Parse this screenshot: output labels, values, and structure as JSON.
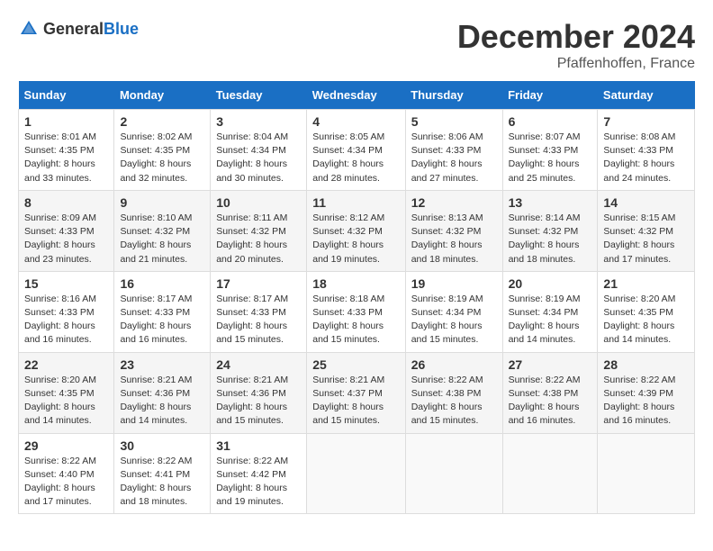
{
  "header": {
    "logo_general": "General",
    "logo_blue": "Blue",
    "title": "December 2024",
    "location": "Pfaffenhoffen, France"
  },
  "days_of_week": [
    "Sunday",
    "Monday",
    "Tuesday",
    "Wednesday",
    "Thursday",
    "Friday",
    "Saturday"
  ],
  "weeks": [
    [
      {
        "day": "1",
        "sunrise": "8:01 AM",
        "sunset": "4:35 PM",
        "daylight": "8 hours and 33 minutes."
      },
      {
        "day": "2",
        "sunrise": "8:02 AM",
        "sunset": "4:35 PM",
        "daylight": "8 hours and 32 minutes."
      },
      {
        "day": "3",
        "sunrise": "8:04 AM",
        "sunset": "4:34 PM",
        "daylight": "8 hours and 30 minutes."
      },
      {
        "day": "4",
        "sunrise": "8:05 AM",
        "sunset": "4:34 PM",
        "daylight": "8 hours and 28 minutes."
      },
      {
        "day": "5",
        "sunrise": "8:06 AM",
        "sunset": "4:33 PM",
        "daylight": "8 hours and 27 minutes."
      },
      {
        "day": "6",
        "sunrise": "8:07 AM",
        "sunset": "4:33 PM",
        "daylight": "8 hours and 25 minutes."
      },
      {
        "day": "7",
        "sunrise": "8:08 AM",
        "sunset": "4:33 PM",
        "daylight": "8 hours and 24 minutes."
      }
    ],
    [
      {
        "day": "8",
        "sunrise": "8:09 AM",
        "sunset": "4:33 PM",
        "daylight": "8 hours and 23 minutes."
      },
      {
        "day": "9",
        "sunrise": "8:10 AM",
        "sunset": "4:32 PM",
        "daylight": "8 hours and 21 minutes."
      },
      {
        "day": "10",
        "sunrise": "8:11 AM",
        "sunset": "4:32 PM",
        "daylight": "8 hours and 20 minutes."
      },
      {
        "day": "11",
        "sunrise": "8:12 AM",
        "sunset": "4:32 PM",
        "daylight": "8 hours and 19 minutes."
      },
      {
        "day": "12",
        "sunrise": "8:13 AM",
        "sunset": "4:32 PM",
        "daylight": "8 hours and 18 minutes."
      },
      {
        "day": "13",
        "sunrise": "8:14 AM",
        "sunset": "4:32 PM",
        "daylight": "8 hours and 18 minutes."
      },
      {
        "day": "14",
        "sunrise": "8:15 AM",
        "sunset": "4:32 PM",
        "daylight": "8 hours and 17 minutes."
      }
    ],
    [
      {
        "day": "15",
        "sunrise": "8:16 AM",
        "sunset": "4:33 PM",
        "daylight": "8 hours and 16 minutes."
      },
      {
        "day": "16",
        "sunrise": "8:17 AM",
        "sunset": "4:33 PM",
        "daylight": "8 hours and 16 minutes."
      },
      {
        "day": "17",
        "sunrise": "8:17 AM",
        "sunset": "4:33 PM",
        "daylight": "8 hours and 15 minutes."
      },
      {
        "day": "18",
        "sunrise": "8:18 AM",
        "sunset": "4:33 PM",
        "daylight": "8 hours and 15 minutes."
      },
      {
        "day": "19",
        "sunrise": "8:19 AM",
        "sunset": "4:34 PM",
        "daylight": "8 hours and 15 minutes."
      },
      {
        "day": "20",
        "sunrise": "8:19 AM",
        "sunset": "4:34 PM",
        "daylight": "8 hours and 14 minutes."
      },
      {
        "day": "21",
        "sunrise": "8:20 AM",
        "sunset": "4:35 PM",
        "daylight": "8 hours and 14 minutes."
      }
    ],
    [
      {
        "day": "22",
        "sunrise": "8:20 AM",
        "sunset": "4:35 PM",
        "daylight": "8 hours and 14 minutes."
      },
      {
        "day": "23",
        "sunrise": "8:21 AM",
        "sunset": "4:36 PM",
        "daylight": "8 hours and 14 minutes."
      },
      {
        "day": "24",
        "sunrise": "8:21 AM",
        "sunset": "4:36 PM",
        "daylight": "8 hours and 15 minutes."
      },
      {
        "day": "25",
        "sunrise": "8:21 AM",
        "sunset": "4:37 PM",
        "daylight": "8 hours and 15 minutes."
      },
      {
        "day": "26",
        "sunrise": "8:22 AM",
        "sunset": "4:38 PM",
        "daylight": "8 hours and 15 minutes."
      },
      {
        "day": "27",
        "sunrise": "8:22 AM",
        "sunset": "4:38 PM",
        "daylight": "8 hours and 16 minutes."
      },
      {
        "day": "28",
        "sunrise": "8:22 AM",
        "sunset": "4:39 PM",
        "daylight": "8 hours and 16 minutes."
      }
    ],
    [
      {
        "day": "29",
        "sunrise": "8:22 AM",
        "sunset": "4:40 PM",
        "daylight": "8 hours and 17 minutes."
      },
      {
        "day": "30",
        "sunrise": "8:22 AM",
        "sunset": "4:41 PM",
        "daylight": "8 hours and 18 minutes."
      },
      {
        "day": "31",
        "sunrise": "8:22 AM",
        "sunset": "4:42 PM",
        "daylight": "8 hours and 19 minutes."
      },
      null,
      null,
      null,
      null
    ]
  ]
}
